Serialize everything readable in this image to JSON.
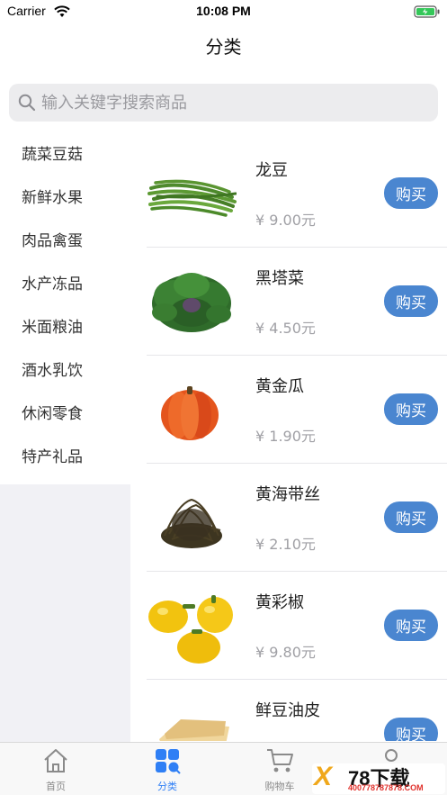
{
  "status_bar": {
    "carrier": "Carrier",
    "time": "10:08 PM"
  },
  "nav": {
    "title": "分类"
  },
  "search": {
    "placeholder": "输入关键字搜索商品",
    "value": ""
  },
  "sidebar": {
    "items": [
      {
        "label": "蔬菜豆菇"
      },
      {
        "label": "新鲜水果"
      },
      {
        "label": "肉品禽蛋"
      },
      {
        "label": "水产冻品"
      },
      {
        "label": "米面粮油"
      },
      {
        "label": "酒水乳饮"
      },
      {
        "label": "休闲零食"
      },
      {
        "label": "特产礼品"
      }
    ]
  },
  "products": [
    {
      "name": "龙豆",
      "price": "¥ 9.00元",
      "buy_label": "购买",
      "image": "green-beans"
    },
    {
      "name": "黑塔菜",
      "price": "¥ 4.50元",
      "buy_label": "购买",
      "image": "leafy-greens"
    },
    {
      "name": "黄金瓜",
      "price": "¥ 1.90元",
      "buy_label": "购买",
      "image": "pumpkin"
    },
    {
      "name": "黄海带丝",
      "price": "¥ 2.10元",
      "buy_label": "购买",
      "image": "kelp-strands"
    },
    {
      "name": "黄彩椒",
      "price": "¥ 9.80元",
      "buy_label": "购买",
      "image": "yellow-peppers"
    },
    {
      "name": "鲜豆油皮",
      "price": "",
      "buy_label": "购买",
      "image": "tofu-skin"
    }
  ],
  "tab_bar": {
    "tabs": [
      {
        "label": "首页",
        "icon": "home-icon",
        "active": false
      },
      {
        "label": "分类",
        "icon": "grid-icon",
        "active": true
      },
      {
        "label": "购物车",
        "icon": "cart-icon",
        "active": false
      },
      {
        "label": "",
        "icon": "profile-icon",
        "active": false
      }
    ]
  },
  "watermark": {
    "brand": "78下载",
    "url": "400778787878.COM"
  },
  "colors": {
    "accent": "#2f7ff5",
    "buy_button": "#4a86d0",
    "sidebar_bg": "#f1f1f5"
  }
}
